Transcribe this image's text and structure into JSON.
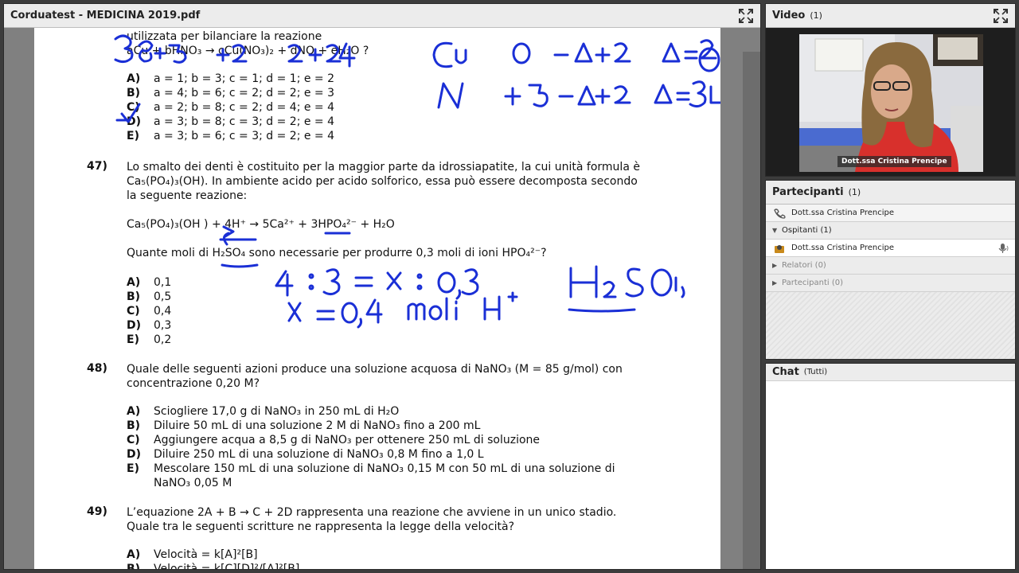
{
  "document": {
    "title": "Corduatest - MEDICINA 2019.pdf",
    "fullscreen_icon": "fullscreen-icon",
    "q46": {
      "line1": "utilizzata per bilanciare la reazione",
      "line2": "aCu + bHNO₃ → cCu(NO₃)₂ + dNO + eH₂O ?",
      "options": [
        {
          "letter": "A)",
          "text": "a = 1; b = 3; c = 1; d = 1; e = 2"
        },
        {
          "letter": "B)",
          "text": "a = 4; b = 6; c = 2; d = 2; e = 3"
        },
        {
          "letter": "C)",
          "text": "a = 2; b = 8; c = 2; d = 4; e = 4"
        },
        {
          "letter": "D)",
          "text": "a = 3; b = 8; c = 3; d = 2; e = 4"
        },
        {
          "letter": "E)",
          "text": "a = 3; b = 6; c = 3; d = 2; e = 4"
        }
      ]
    },
    "q47": {
      "number": "47)",
      "line1": "Lo smalto dei denti è costituito per la maggior parte da idrossiapatite, la cui unità formula è",
      "line2": "Ca₅(PO₄)₃(OH). In ambiente acido per acido solforico, essa può essere decomposta secondo",
      "line3": "la seguente reazione:",
      "reaction": "Ca₅(PO₄)₃(OH ) + 4H⁺ →  5Ca²⁺ + 3HPO₄²⁻ +  H₂O",
      "question": "Quante moli di H₂SO₄ sono necessarie per produrre 0,3 moli di ioni HPO₄²⁻?",
      "options": [
        {
          "letter": "A)",
          "text": "0,1"
        },
        {
          "letter": "B)",
          "text": "0,5"
        },
        {
          "letter": "C)",
          "text": "0,4"
        },
        {
          "letter": "D)",
          "text": "0,3"
        },
        {
          "letter": "E)",
          "text": "0,2"
        }
      ]
    },
    "q48": {
      "number": "48)",
      "line1": "Quale delle seguenti azioni produce una soluzione acquosa di NaNO₃ (M = 85 g/mol) con",
      "line2": "concentrazione 0,20 M?",
      "options": [
        {
          "letter": "A)",
          "text": "Sciogliere 17,0 g di NaNO₃ in 250 mL di H₂O"
        },
        {
          "letter": "B)",
          "text": "Diluire 50 mL di una soluzione 2 M di NaNO₃ fino a 200 mL"
        },
        {
          "letter": "C)",
          "text": "Aggiungere acqua a 8,5 g di NaNO₃ per ottenere 250 mL di soluzione"
        },
        {
          "letter": "D)",
          "text": "Diluire 250 mL di una soluzione di NaNO₃ 0,8 M fino a 1,0 L"
        },
        {
          "letter": "E)",
          "text": "Mescolare 150 mL di una soluzione di NaNO₃ 0,15 M con 50 mL di una soluzione di"
        }
      ],
      "option_e_line2": "NaNO₃ 0,05 M"
    },
    "q49": {
      "number": "49)",
      "line1": "L’equazione 2A + B → C + 2D rappresenta una reazione che avviene in un unico stadio.",
      "line2": "Quale tra le seguenti scritture ne rappresenta la legge della velocità?",
      "options": [
        {
          "letter": "A)",
          "text": "Velocità = k[A]²[B]"
        },
        {
          "letter": "B)",
          "text": "Velocità = k[C][D]²/[A]²[B]"
        }
      ]
    },
    "handwriting": {
      "ox_cu": "Cu   0  –Δ+2  Δ=2",
      "ox_n": "N   +5  –Δ+2  Δ=3",
      "top_numbers": "3  8  +5  +2  2  +2  4",
      "proportion": "4 : 3 = x : 0,3",
      "result": "x = 0,4 moli H⁺",
      "acid": "H₂SO₄"
    },
    "ink_color": "#1a2fd6"
  },
  "video": {
    "title": "Video",
    "count": "(1)",
    "caption": "Dott.ssa Cristina Prencipe",
    "fullscreen_icon": "fullscreen-icon"
  },
  "participants": {
    "title": "Partecipanti",
    "count": "(1)",
    "host": "Dott.ssa Cristina Prencipe",
    "groups": [
      {
        "label": "Ospitanti (1)",
        "expanded": true
      },
      {
        "label": "Relatori (0)",
        "expanded": false
      },
      {
        "label": "Partecipanti (0)",
        "expanded": false
      }
    ],
    "member": "Dott.ssa Cristina Prencipe"
  },
  "chat": {
    "title": "Chat",
    "scope": "(Tutti)"
  }
}
